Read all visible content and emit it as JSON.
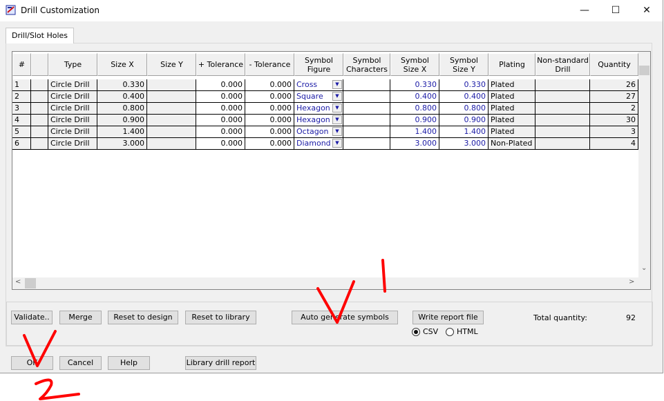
{
  "window": {
    "title": "Drill Customization",
    "controls": {
      "minimize": "—",
      "maximize": "☐",
      "close": "✕"
    }
  },
  "tabs": [
    {
      "label": "Drill/Slot Holes",
      "selected": true
    }
  ],
  "table": {
    "headers": [
      "#",
      "",
      "Type",
      "Size X",
      "Size Y",
      "+ Tolerance",
      "- Tolerance",
      "Symbol\nFigure",
      "Symbol\nCharacters",
      "Symbol\nSize X",
      "Symbol\nSize Y",
      "Plating",
      "Non-standard\nDrill",
      "Quantity"
    ],
    "rows": [
      {
        "num": "1",
        "type": "Circle Drill",
        "size_x": "0.330",
        "size_y": "",
        "plus_tol": "0.000",
        "minus_tol": "0.000",
        "symbol_figure": "Cross",
        "symbol_chars": "",
        "symbol_size_x": "0.330",
        "symbol_size_y": "0.330",
        "plating": "Plated",
        "non_standard": "",
        "quantity": "26"
      },
      {
        "num": "2",
        "type": "Circle Drill",
        "size_x": "0.400",
        "size_y": "",
        "plus_tol": "0.000",
        "minus_tol": "0.000",
        "symbol_figure": "Square",
        "symbol_chars": "",
        "symbol_size_x": "0.400",
        "symbol_size_y": "0.400",
        "plating": "Plated",
        "non_standard": "",
        "quantity": "27"
      },
      {
        "num": "3",
        "type": "Circle Drill",
        "size_x": "0.800",
        "size_y": "",
        "plus_tol": "0.000",
        "minus_tol": "0.000",
        "symbol_figure": "Hexagon X",
        "symbol_chars": "",
        "symbol_size_x": "0.800",
        "symbol_size_y": "0.800",
        "plating": "Plated",
        "non_standard": "",
        "quantity": "2"
      },
      {
        "num": "4",
        "type": "Circle Drill",
        "size_x": "0.900",
        "size_y": "",
        "plus_tol": "0.000",
        "minus_tol": "0.000",
        "symbol_figure": "Hexagon Y",
        "symbol_chars": "",
        "symbol_size_x": "0.900",
        "symbol_size_y": "0.900",
        "plating": "Plated",
        "non_standard": "",
        "quantity": "30"
      },
      {
        "num": "5",
        "type": "Circle Drill",
        "size_x": "1.400",
        "size_y": "",
        "plus_tol": "0.000",
        "minus_tol": "0.000",
        "symbol_figure": "Octagon",
        "symbol_chars": "",
        "symbol_size_x": "1.400",
        "symbol_size_y": "1.400",
        "plating": "Plated",
        "non_standard": "",
        "quantity": "3"
      },
      {
        "num": "6",
        "type": "Circle Drill",
        "size_x": "3.000",
        "size_y": "",
        "plus_tol": "0.000",
        "minus_tol": "0.000",
        "symbol_figure": "Diamond",
        "symbol_chars": "",
        "symbol_size_x": "3.000",
        "symbol_size_y": "3.000",
        "plating": "Non-Plated",
        "non_standard": "",
        "quantity": "4"
      }
    ]
  },
  "actions": {
    "validate": "Validate..",
    "merge": "Merge",
    "reset_design": "Reset to design",
    "reset_library": "Reset to library",
    "auto_generate": "Auto generate symbols",
    "write_report": "Write report file",
    "total_label": "Total quantity:",
    "total_value": "92",
    "format_csv": "CSV",
    "format_html": "HTML",
    "format_selected": "CSV"
  },
  "footer": {
    "ok": "OK",
    "cancel": "Cancel",
    "help": "Help",
    "library_report": "Library drill report"
  },
  "annotations": {
    "color": "#ff0000",
    "marks": [
      "1",
      "2"
    ]
  }
}
